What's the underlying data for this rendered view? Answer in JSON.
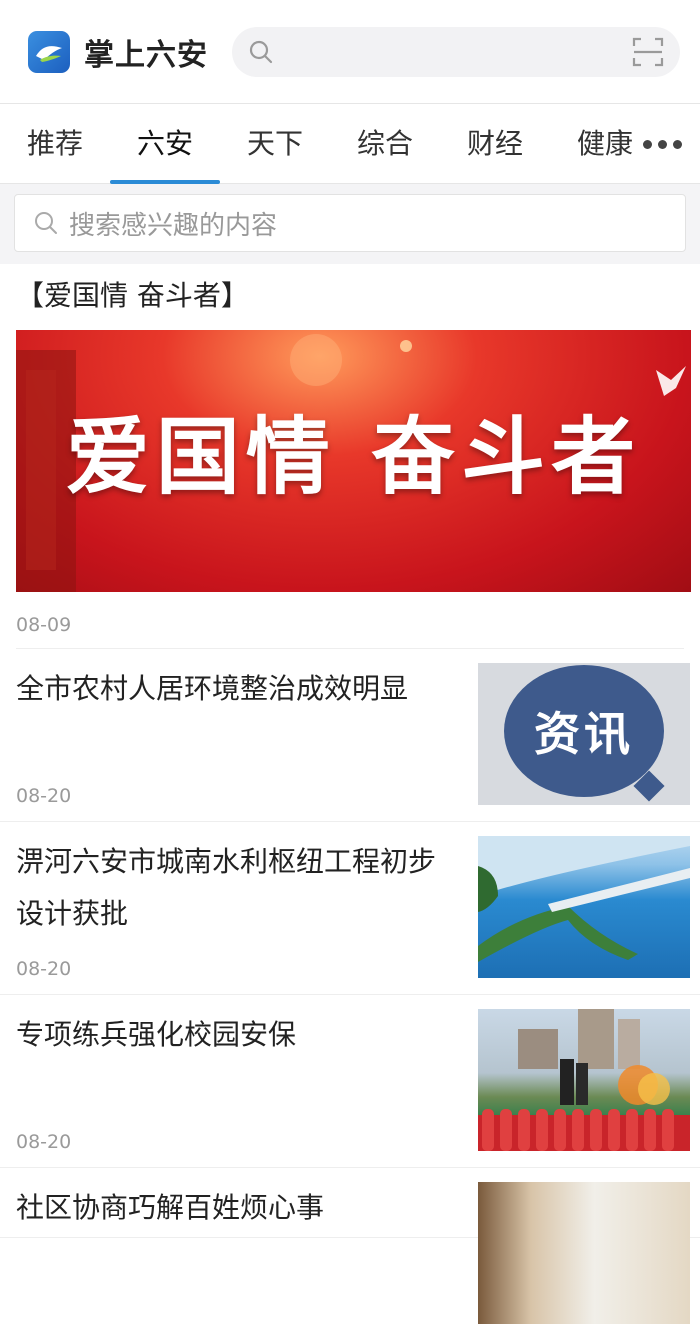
{
  "app": {
    "name": "掌上六安",
    "logo_icon": "app-logo-icon"
  },
  "header": {
    "search_icon": "search-icon",
    "scan_icon": "scan-icon"
  },
  "tabs": [
    {
      "label": "推荐",
      "active": false
    },
    {
      "label": "六安",
      "active": true
    },
    {
      "label": "天下",
      "active": false
    },
    {
      "label": "综合",
      "active": false
    },
    {
      "label": "财经",
      "active": false
    },
    {
      "label": "健康",
      "active": false
    }
  ],
  "tabs_more_icon": "more-dots-icon",
  "search": {
    "placeholder": "搜索感兴趣的内容",
    "icon": "search-icon"
  },
  "featured": {
    "title": "【爱国情 奋斗者】",
    "banner_text": "爱国情  奋斗者",
    "date": "08-09"
  },
  "news": [
    {
      "title": "全市农村人居环境整治成效明显",
      "date": "08-20",
      "thumb": "资讯"
    },
    {
      "title": "淠河六安市城南水利枢纽工程初步设计获批",
      "date": "08-20"
    },
    {
      "title": "专项练兵强化校园安保",
      "date": "08-20"
    },
    {
      "title": "社区协商巧解百姓烦心事"
    }
  ],
  "colors": {
    "accent": "#2b8bd6",
    "banner_red": "#c8141c",
    "zixun_blue": "#3e5a8c"
  }
}
